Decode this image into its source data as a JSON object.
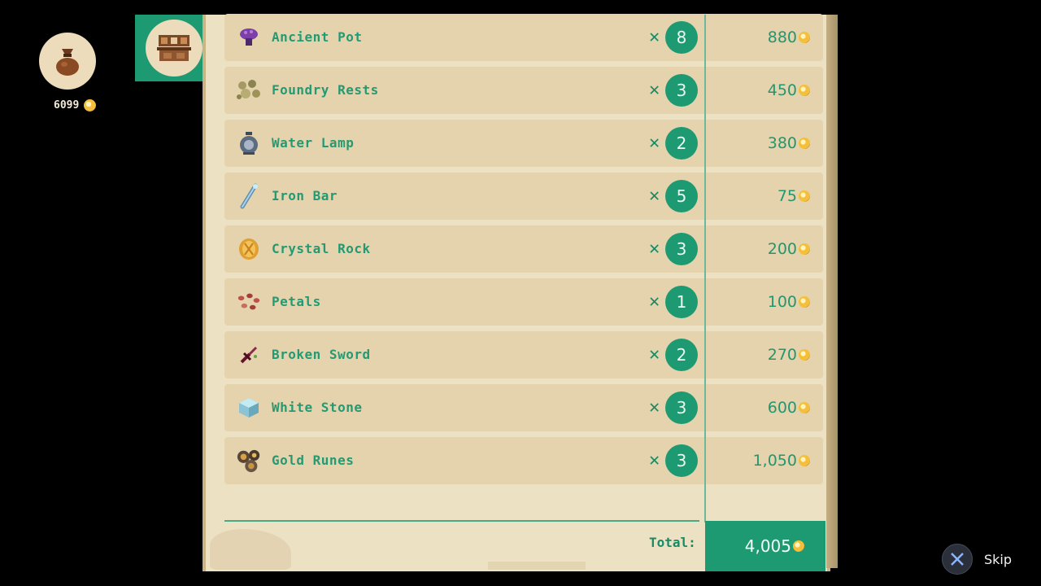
{
  "wallet": {
    "icon": "money-bag-icon",
    "amount": "6099"
  },
  "shop": {
    "icon": "shop-counter-icon"
  },
  "items": [
    {
      "name": "Ancient Pot",
      "icon": "ancient-pot-icon",
      "qty": "8",
      "price": "880"
    },
    {
      "name": "Foundry Rests",
      "icon": "foundry-rests-icon",
      "qty": "3",
      "price": "450"
    },
    {
      "name": "Water Lamp",
      "icon": "water-lamp-icon",
      "qty": "2",
      "price": "380"
    },
    {
      "name": "Iron Bar",
      "icon": "iron-bar-icon",
      "qty": "5",
      "price": "75"
    },
    {
      "name": "Crystal Rock",
      "icon": "crystal-rock-icon",
      "qty": "3",
      "price": "200"
    },
    {
      "name": "Petals",
      "icon": "petals-icon",
      "qty": "1",
      "price": "100"
    },
    {
      "name": "Broken Sword",
      "icon": "broken-sword-icon",
      "qty": "2",
      "price": "270"
    },
    {
      "name": "White Stone",
      "icon": "white-stone-icon",
      "qty": "3",
      "price": "600"
    },
    {
      "name": "Gold Runes",
      "icon": "gold-runes-icon",
      "qty": "3",
      "price": "1,050"
    }
  ],
  "multiplier_symbol": "✕",
  "total": {
    "label": "Total:",
    "value": "4,005"
  },
  "skip": {
    "button_glyph": "✕",
    "label": "Skip"
  },
  "colors": {
    "accent": "#1e9a72",
    "paper": "#ede1c3",
    "row": "#e5d3ad",
    "text": "#259a72"
  }
}
